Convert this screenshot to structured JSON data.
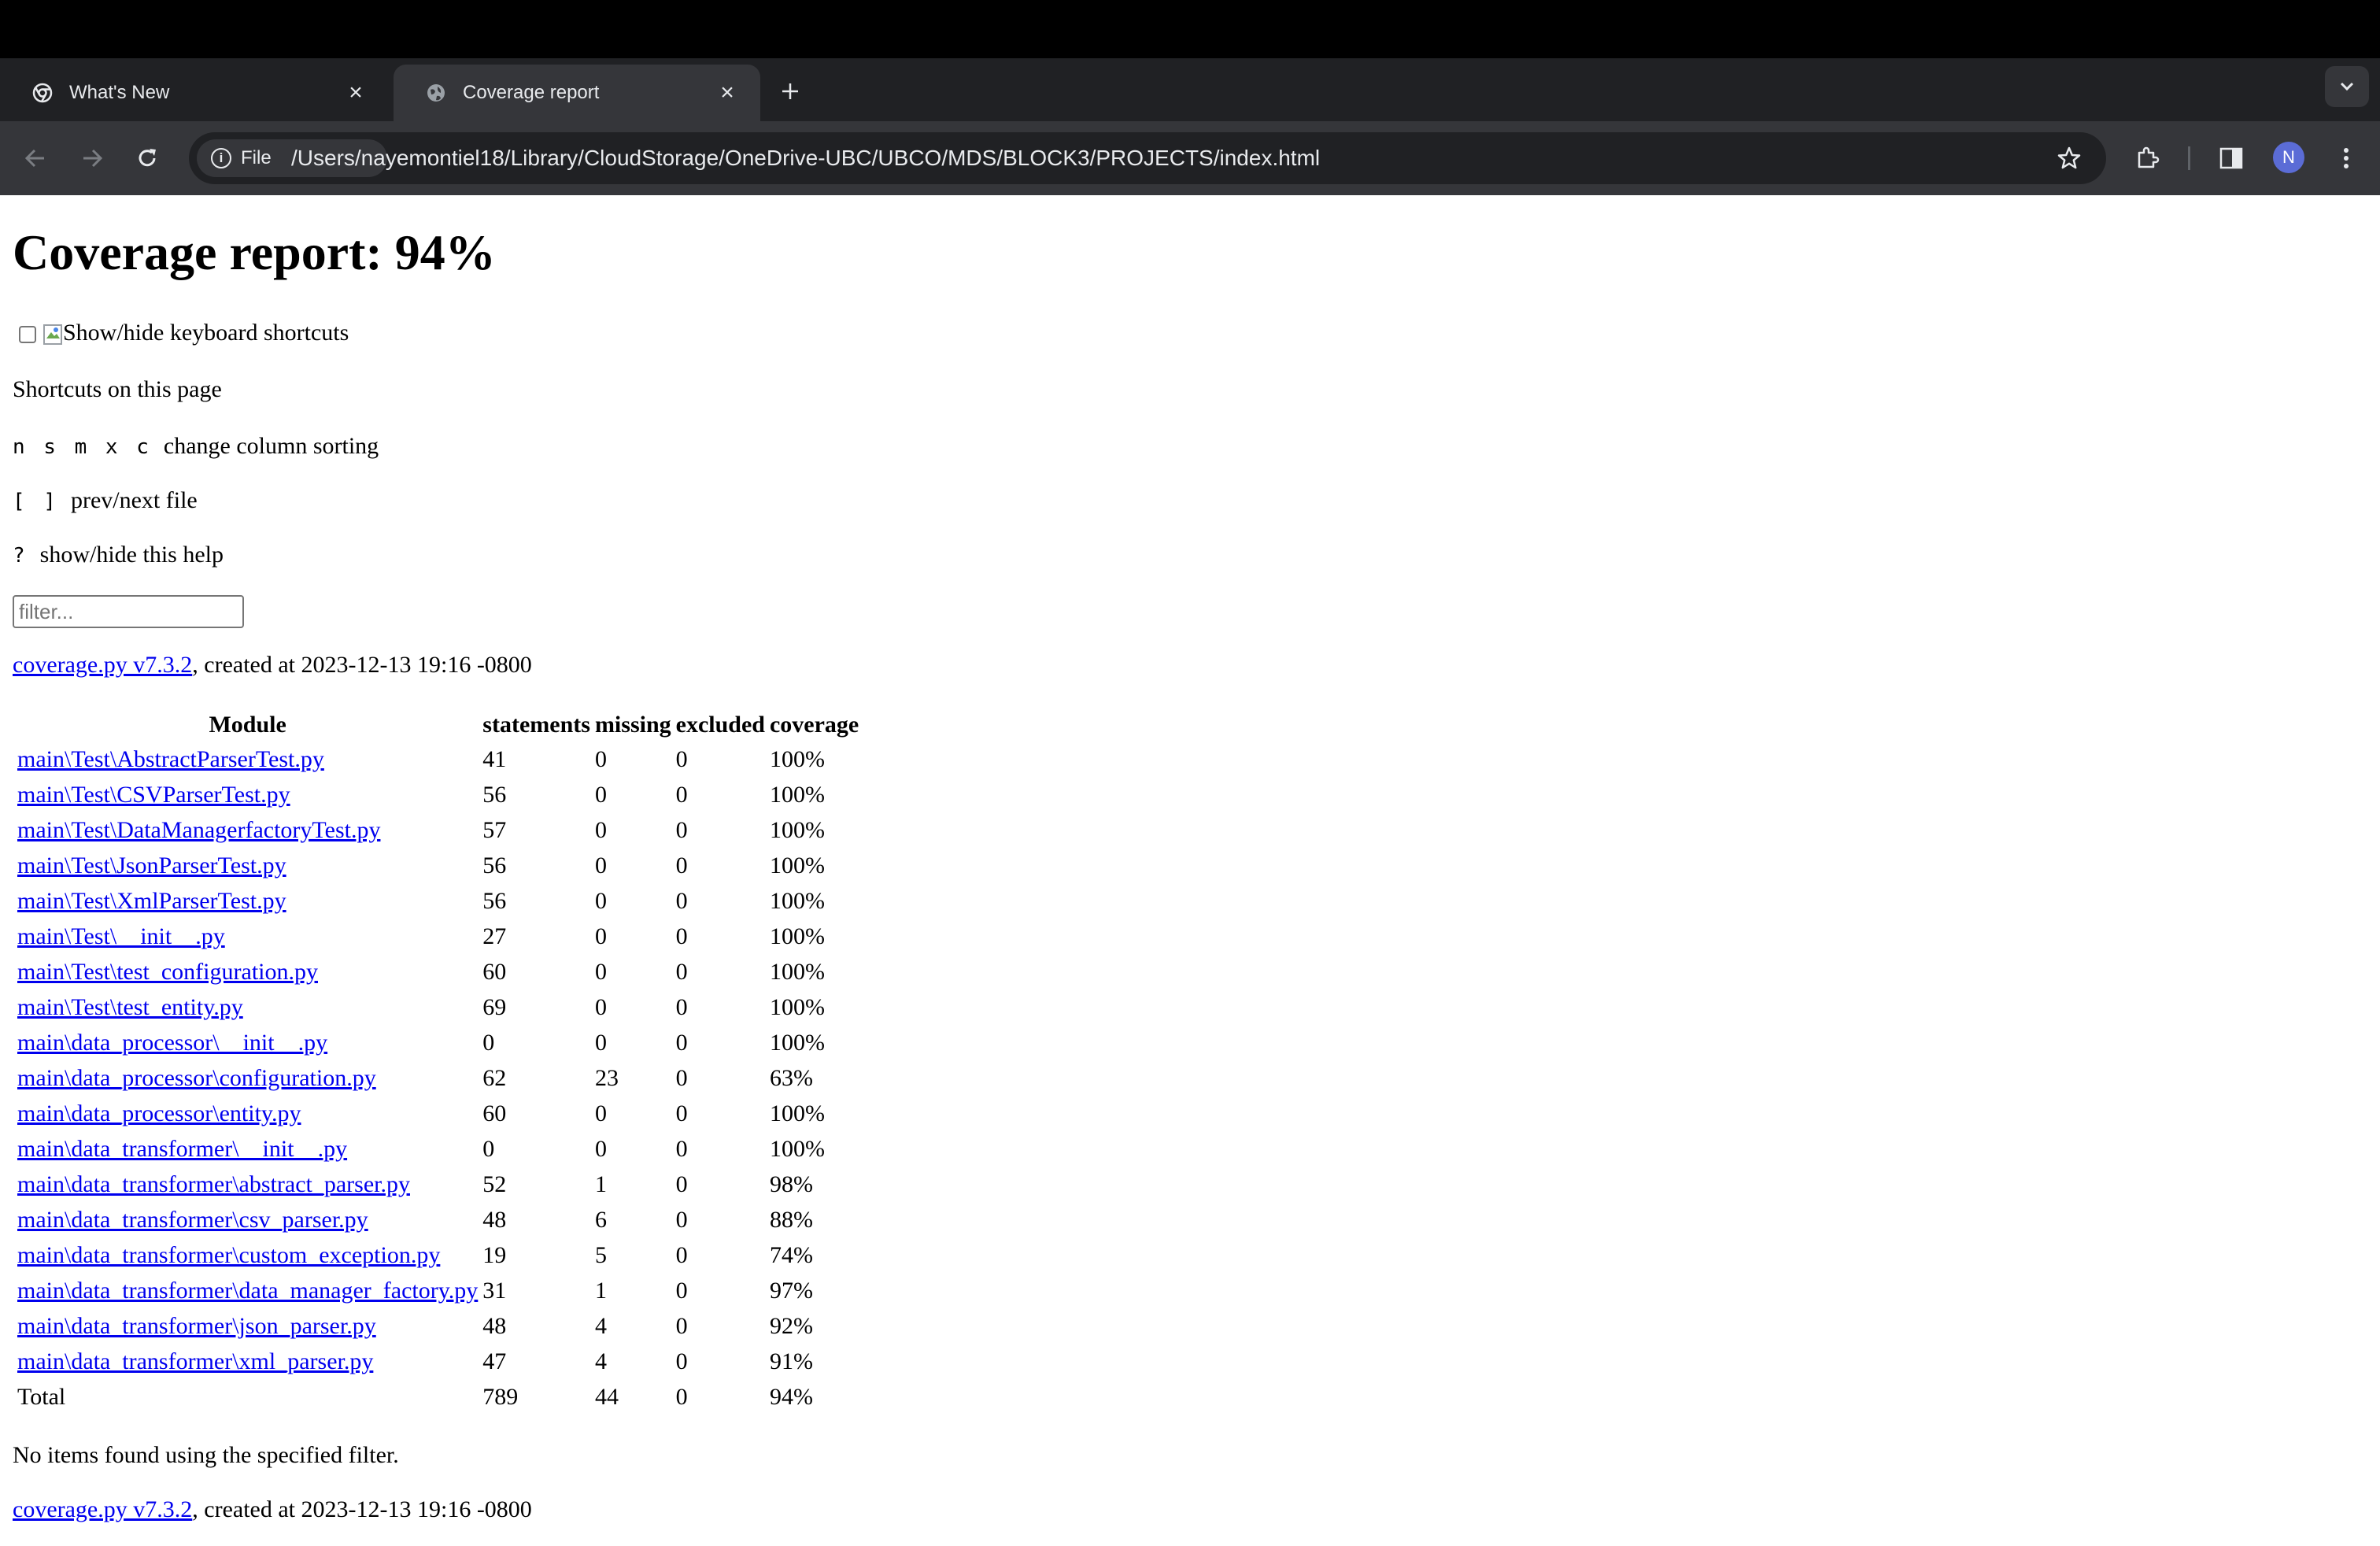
{
  "browser": {
    "tabs": [
      {
        "title": "What's New",
        "active": false
      },
      {
        "title": "Coverage report",
        "active": true
      }
    ],
    "omnibox": {
      "chip_label": "File",
      "url": "/Users/nayemontiel18/Library/CloudStorage/OneDrive-UBC/UBCO/MDS/BLOCK3/PROJECTS/index.html"
    },
    "profile_initial": "N"
  },
  "page": {
    "title": "Coverage report: 94%",
    "keyboard_toggle_label": "Show/hide keyboard shortcuts",
    "shortcuts_heading": "Shortcuts on this page",
    "shortcuts": [
      {
        "keys": "n s m x c",
        "desc": "change column sorting"
      },
      {
        "keys": "[ ]",
        "desc": "prev/next file"
      },
      {
        "keys": "?",
        "desc": "show/hide this help"
      }
    ],
    "filter_placeholder": "filter...",
    "created": {
      "link": "coverage.py v7.3.2",
      "suffix": ", created at 2023-12-13 19:16 -0800"
    },
    "table": {
      "headers": [
        "Module",
        "statements",
        "missing",
        "excluded",
        "coverage"
      ],
      "rows": [
        {
          "module": "main\\Test\\AbstractParserTest.py",
          "statements": "41",
          "missing": "0",
          "excluded": "0",
          "coverage": "100%"
        },
        {
          "module": "main\\Test\\CSVParserTest.py",
          "statements": "56",
          "missing": "0",
          "excluded": "0",
          "coverage": "100%"
        },
        {
          "module": "main\\Test\\DataManagerfactoryTest.py",
          "statements": "57",
          "missing": "0",
          "excluded": "0",
          "coverage": "100%"
        },
        {
          "module": "main\\Test\\JsonParserTest.py",
          "statements": "56",
          "missing": "0",
          "excluded": "0",
          "coverage": "100%"
        },
        {
          "module": "main\\Test\\XmlParserTest.py",
          "statements": "56",
          "missing": "0",
          "excluded": "0",
          "coverage": "100%"
        },
        {
          "module": "main\\Test\\__init__.py",
          "statements": "27",
          "missing": "0",
          "excluded": "0",
          "coverage": "100%"
        },
        {
          "module": "main\\Test\\test_configuration.py",
          "statements": "60",
          "missing": "0",
          "excluded": "0",
          "coverage": "100%"
        },
        {
          "module": "main\\Test\\test_entity.py",
          "statements": "69",
          "missing": "0",
          "excluded": "0",
          "coverage": "100%"
        },
        {
          "module": "main\\data_processor\\__init__.py",
          "statements": "0",
          "missing": "0",
          "excluded": "0",
          "coverage": "100%"
        },
        {
          "module": "main\\data_processor\\configuration.py",
          "statements": "62",
          "missing": "23",
          "excluded": "0",
          "coverage": "63%"
        },
        {
          "module": "main\\data_processor\\entity.py",
          "statements": "60",
          "missing": "0",
          "excluded": "0",
          "coverage": "100%"
        },
        {
          "module": "main\\data_transformer\\__init__.py",
          "statements": "0",
          "missing": "0",
          "excluded": "0",
          "coverage": "100%"
        },
        {
          "module": "main\\data_transformer\\abstract_parser.py",
          "statements": "52",
          "missing": "1",
          "excluded": "0",
          "coverage": "98%"
        },
        {
          "module": "main\\data_transformer\\csv_parser.py",
          "statements": "48",
          "missing": "6",
          "excluded": "0",
          "coverage": "88%"
        },
        {
          "module": "main\\data_transformer\\custom_exception.py",
          "statements": "19",
          "missing": "5",
          "excluded": "0",
          "coverage": "74%"
        },
        {
          "module": "main\\data_transformer\\data_manager_factory.py",
          "statements": "31",
          "missing": "1",
          "excluded": "0",
          "coverage": "97%"
        },
        {
          "module": "main\\data_transformer\\json_parser.py",
          "statements": "48",
          "missing": "4",
          "excluded": "0",
          "coverage": "92%"
        },
        {
          "module": "main\\data_transformer\\xml_parser.py",
          "statements": "47",
          "missing": "4",
          "excluded": "0",
          "coverage": "91%"
        }
      ],
      "total": {
        "label": "Total",
        "statements": "789",
        "missing": "44",
        "excluded": "0",
        "coverage": "94%"
      }
    },
    "no_items_text": "No items found using the specified filter."
  }
}
